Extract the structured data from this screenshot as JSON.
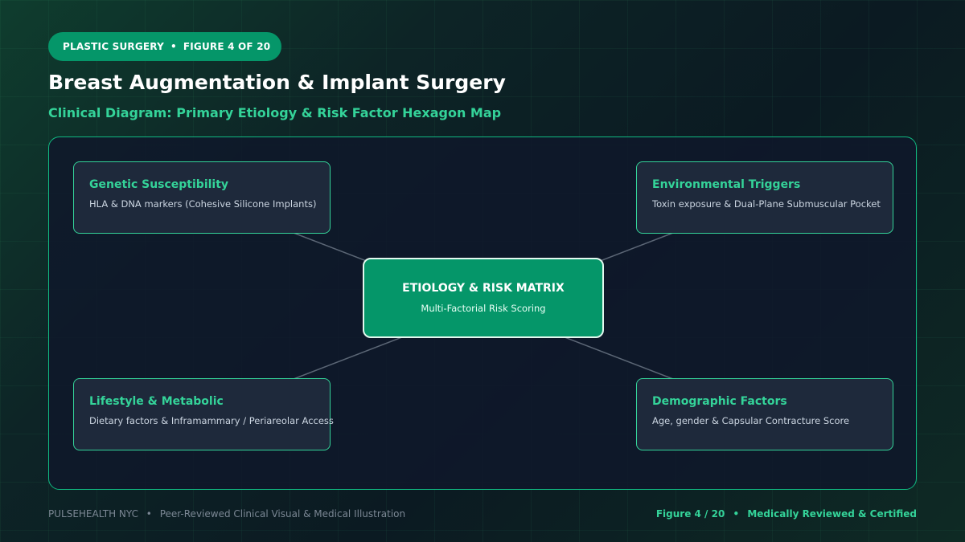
{
  "header": {
    "badge_category": "PLASTIC SURGERY",
    "badge_separator": "•",
    "badge_figure": "FIGURE 4 OF 20",
    "title": "Breast Augmentation & Implant Surgery",
    "subtitle": "Clinical Diagram: Primary Etiology & Risk Factor Hexagon Map"
  },
  "diagram": {
    "center": {
      "label": "ETIOLOGY & RISK MATRIX",
      "description": "Multi-Factorial Risk Scoring"
    },
    "nodes": [
      {
        "label": "Genetic Susceptibility",
        "description": "HLA & DNA markers (Cohesive Silicone Implants)"
      },
      {
        "label": "Environmental Triggers",
        "description": "Toxin exposure & Dual-Plane Submuscular Pocket"
      },
      {
        "label": "Lifestyle & Metabolic",
        "description": "Dietary factors & Inframammary / Periareolar Access"
      },
      {
        "label": "Demographic Factors",
        "description": "Age, gender & Capsular Contracture Score"
      }
    ]
  },
  "footer": {
    "brand": "PULSEHEALTH NYC",
    "separator": "•",
    "tagline": "Peer-Reviewed Clinical Visual & Medical Illustration",
    "figure": "Figure 4 / 20",
    "certification": "Medically Reviewed & Certified"
  },
  "colors": {
    "accent": "#34d399",
    "accent_dark": "#059669",
    "panel_bg": "#0f172a",
    "node_bg": "#1e293b",
    "muted_text": "#7b8794"
  }
}
